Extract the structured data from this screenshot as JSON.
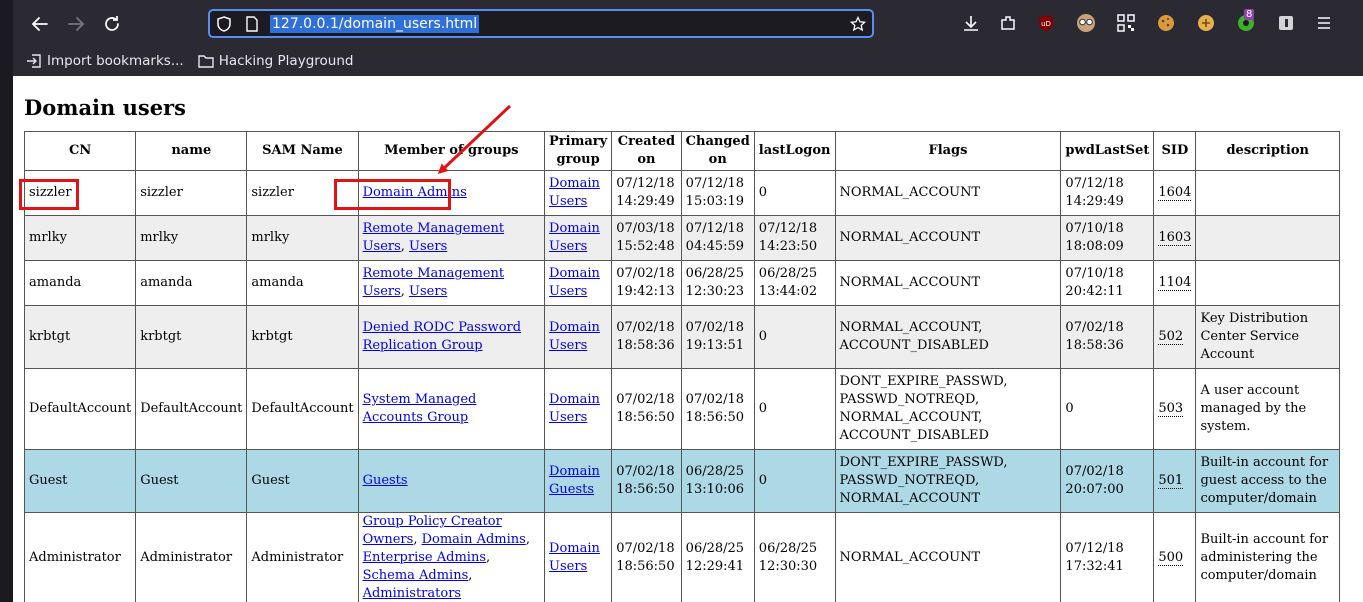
{
  "browser": {
    "url": "127.0.0.1/domain_users.html",
    "bookmarks": [
      {
        "label": "Import bookmarks..."
      },
      {
        "label": "Hacking Playground"
      }
    ],
    "extension_badge": "8"
  },
  "page": {
    "title": "Domain users",
    "columns": [
      "CN",
      "name",
      "SAM Name",
      "Member of groups",
      "Primary group",
      "Created on",
      "Changed on",
      "lastLogon",
      "Flags",
      "pwdLastSet",
      "SID",
      "description"
    ],
    "rows": [
      {
        "cn": "sizzler",
        "name": "sizzler",
        "sam": "sizzler",
        "groups": [
          "Domain Admins"
        ],
        "primary": "Domain Users",
        "created": "07/12/18 14:29:49",
        "changed": "07/12/18 15:03:19",
        "lastlogon": "0",
        "flags": [
          "NORMAL_ACCOUNT"
        ],
        "pwdlastset": "07/12/18 14:29:49",
        "sid": "1604",
        "description": ""
      },
      {
        "cn": "mrlky",
        "name": "mrlky",
        "sam": "mrlky",
        "groups": [
          "Remote Management Users",
          "Users"
        ],
        "primary": "Domain Users",
        "created": "07/03/18 15:52:48",
        "changed": "07/12/18 04:45:59",
        "lastlogon": "07/12/18 14:23:50",
        "flags": [
          "NORMAL_ACCOUNT"
        ],
        "pwdlastset": "07/10/18 18:08:09",
        "sid": "1603",
        "description": ""
      },
      {
        "cn": "amanda",
        "name": "amanda",
        "sam": "amanda",
        "groups": [
          "Remote Management Users",
          "Users"
        ],
        "primary": "Domain Users",
        "created": "07/02/18 19:42:13",
        "changed": "06/28/25 12:30:23",
        "lastlogon": "06/28/25 13:44:02",
        "flags": [
          "NORMAL_ACCOUNT"
        ],
        "pwdlastset": "07/10/18 20:42:11",
        "sid": "1104",
        "description": ""
      },
      {
        "cn": "krbtgt",
        "name": "krbtgt",
        "sam": "krbtgt",
        "groups": [
          "Denied RODC Password Replication Group"
        ],
        "primary": "Domain Users",
        "created": "07/02/18 18:58:36",
        "changed": "07/02/18 19:13:51",
        "lastlogon": "0",
        "flags": [
          "NORMAL_ACCOUNT",
          "ACCOUNT_DISABLED"
        ],
        "pwdlastset": "07/02/18 18:58:36",
        "sid": "502",
        "description": "Key Distribution Center Service Account"
      },
      {
        "cn": "DefaultAccount",
        "name": "DefaultAccount",
        "sam": "DefaultAccount",
        "groups": [
          "System Managed Accounts Group"
        ],
        "primary": "Domain Users",
        "created": "07/02/18 18:56:50",
        "changed": "07/02/18 18:56:50",
        "lastlogon": "0",
        "flags": [
          "DONT_EXPIRE_PASSWD",
          "PASSWD_NOTREQD",
          "NORMAL_ACCOUNT",
          "ACCOUNT_DISABLED"
        ],
        "pwdlastset": "0",
        "sid": "503",
        "description": "A user account managed by the system."
      },
      {
        "cn": "Guest",
        "name": "Guest",
        "sam": "Guest",
        "groups": [
          "Guests"
        ],
        "primary": "Domain Guests",
        "created": "07/02/18 18:56:50",
        "changed": "06/28/25 13:10:06",
        "lastlogon": "0",
        "flags": [
          "DONT_EXPIRE_PASSWD",
          "PASSWD_NOTREQD",
          "NORMAL_ACCOUNT"
        ],
        "pwdlastset": "07/02/18 20:07:00",
        "sid": "501",
        "description": "Built-in account for guest access to the computer/domain"
      },
      {
        "cn": "Administrator",
        "name": "Administrator",
        "sam": "Administrator",
        "groups": [
          "Group Policy Creator Owners",
          "Domain Admins",
          "Enterprise Admins",
          "Schema Admins",
          "Administrators"
        ],
        "primary": "Domain Users",
        "created": "07/02/18 18:56:50",
        "changed": "06/28/25 12:29:41",
        "lastlogon": "06/28/25 12:30:30",
        "flags": [
          "NORMAL_ACCOUNT"
        ],
        "pwdlastset": "07/12/18 17:32:41",
        "sid": "500",
        "description": "Built-in account for administering the computer/domain"
      }
    ]
  },
  "colors": {
    "alt_row": "#eeeeee",
    "highlight_row": "#add8e6",
    "annotation": "#e01414",
    "link": "#0000ee"
  }
}
